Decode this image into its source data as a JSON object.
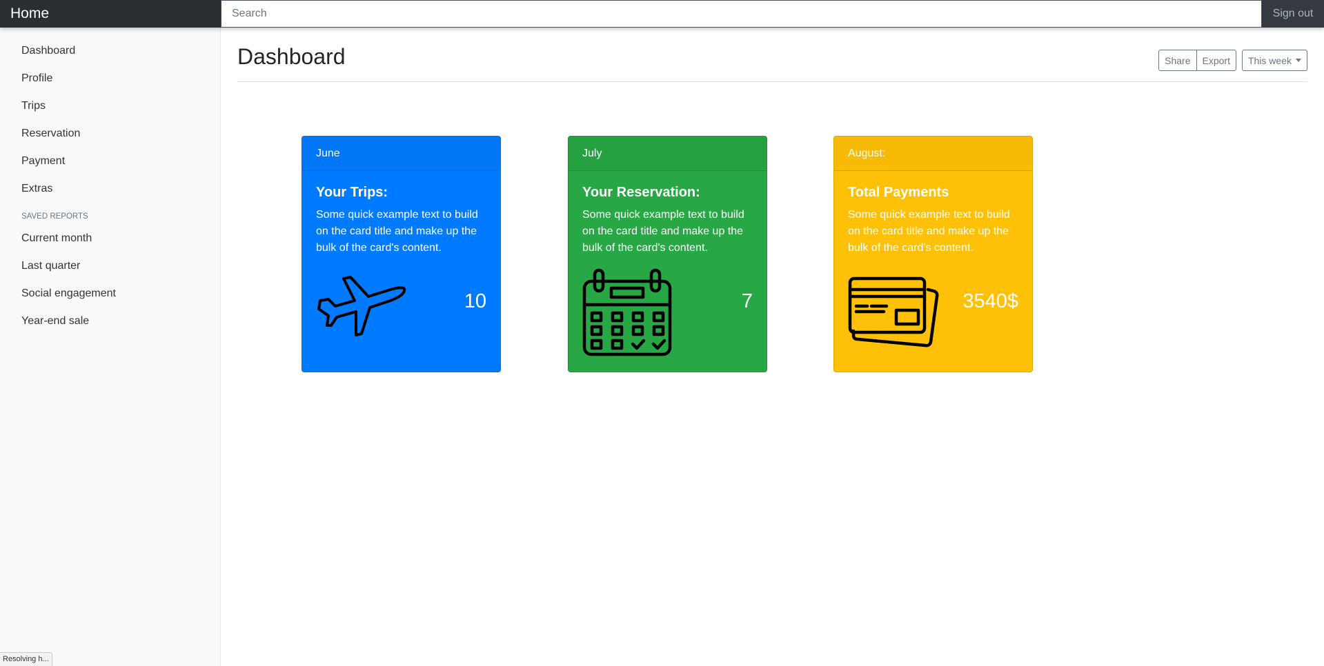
{
  "navbar": {
    "brand": "Home",
    "search_placeholder": "Search",
    "signout_label": "Sign out"
  },
  "sidebar": {
    "items": [
      {
        "label": "Dashboard"
      },
      {
        "label": "Profile"
      },
      {
        "label": "Trips"
      },
      {
        "label": "Reservation"
      },
      {
        "label": "Payment"
      },
      {
        "label": "Extras"
      }
    ],
    "saved_reports_heading": "SAVED REPORTS",
    "reports": [
      {
        "label": "Current month"
      },
      {
        "label": "Last quarter"
      },
      {
        "label": "Social engagement"
      },
      {
        "label": "Year-end sale"
      }
    ]
  },
  "main": {
    "title": "Dashboard",
    "toolbar": {
      "share_label": "Share",
      "export_label": "Export",
      "period_label": "This week"
    },
    "cards": [
      {
        "header": "June",
        "title": "Your Trips:",
        "text": "Some quick example text to build on the card title and make up the bulk of the card's content.",
        "value": "10",
        "icon": "airplane-icon",
        "color": "#007bff"
      },
      {
        "header": "July",
        "title": "Your Reservation:",
        "text": "Some quick example text to build on the card title and make up the bulk of the card's content.",
        "value": "7",
        "icon": "calendar-icon",
        "color": "#28a745"
      },
      {
        "header": "August:",
        "title": "Total Payments",
        "text": "Some quick example text to build on the card title and make up the bulk of the card's content.",
        "value": "3540$",
        "icon": "credit-card-icon",
        "color": "#ffc107"
      }
    ]
  },
  "status_bar": "Resolving h..."
}
